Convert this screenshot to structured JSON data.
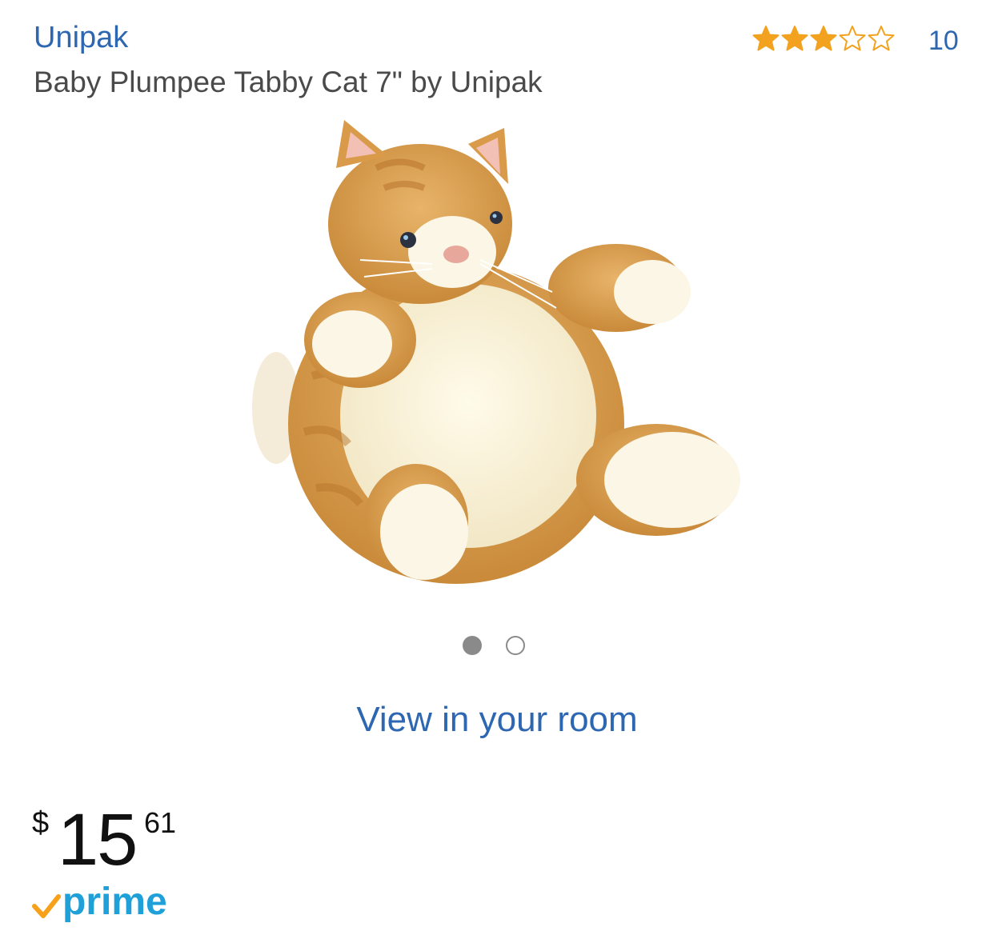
{
  "product": {
    "brand": "Unipak",
    "title": "Baby Plumpee Tabby Cat 7\" by Unipak",
    "rating": 3,
    "rating_max": 5,
    "review_count": "10"
  },
  "gallery": {
    "image_icon": "plush-cat-image",
    "image_count": 2,
    "active_index": 0
  },
  "actions": {
    "view_in_room": "View in your room"
  },
  "price": {
    "symbol": "$",
    "whole": "15",
    "fraction": "61"
  },
  "badge": {
    "prime": "prime"
  },
  "colors": {
    "link_blue": "#2e67b1",
    "star_gold": "#f2a21f",
    "prime_blue": "#1fa0d8",
    "prime_check": "#f7a11a"
  }
}
